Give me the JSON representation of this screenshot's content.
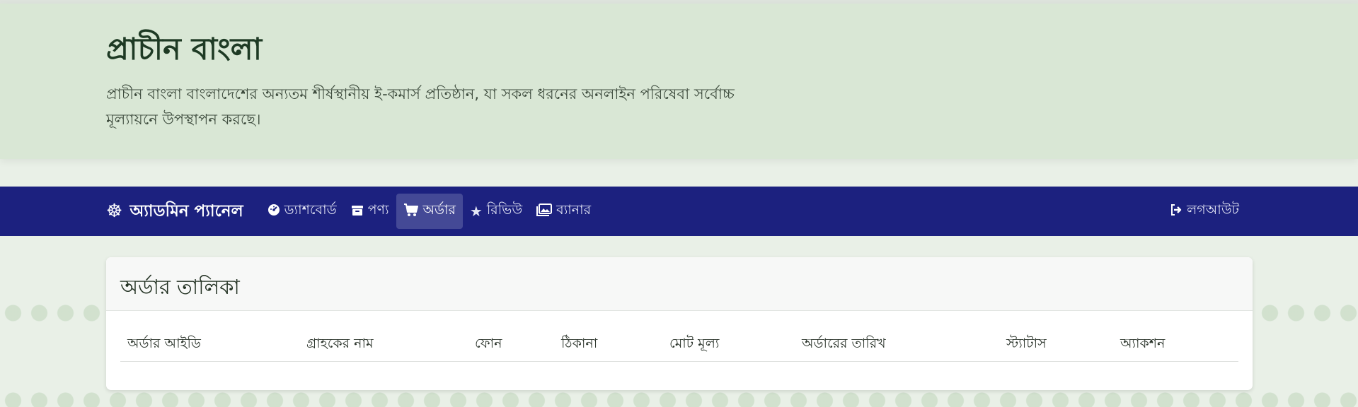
{
  "hero": {
    "title": "প্রাচীন বাংলা",
    "description": "প্রাচীন বাংলা বাংলাদেশের অন্যতম শীর্ষস্থানীয় ই-কমার্স প্রতিষ্ঠান, যা সকল ধরনের অনলাইন পরিষেবা সর্বোচ্চ মূল্যায়নে উপস্থাপন করছে।"
  },
  "navbar": {
    "brand": "অ্যাডমিন প্যানেল",
    "brand_icon": "wheel-icon",
    "items": [
      {
        "label": "ড্যাশবোর্ড",
        "icon": "dashboard-gauge-icon",
        "active": false
      },
      {
        "label": "পণ্য",
        "icon": "box-icon",
        "active": false
      },
      {
        "label": "অর্ডার",
        "icon": "shopping-cart-icon",
        "active": true
      },
      {
        "label": "রিভিউ",
        "icon": "star-icon",
        "active": false
      },
      {
        "label": "ব্যানার",
        "icon": "images-icon",
        "active": false
      }
    ],
    "logout": {
      "label": "লগআউট",
      "icon": "sign-out-icon"
    }
  },
  "orders": {
    "title": "অর্ডার তালিকা",
    "columns": [
      "অর্ডার আইডি",
      "গ্রাহকের নাম",
      "ফোন",
      "ঠিকানা",
      "মোট মূল্য",
      "অর্ডারের তারিখ",
      "স্ট্যাটাস",
      "অ্যাকশন"
    ]
  },
  "colors": {
    "background": "#e9f0e7",
    "hero_background": "#d9e7d5",
    "navbar": "#1c217f",
    "active_nav_item": "rgba(255,255,255,0.18)"
  }
}
